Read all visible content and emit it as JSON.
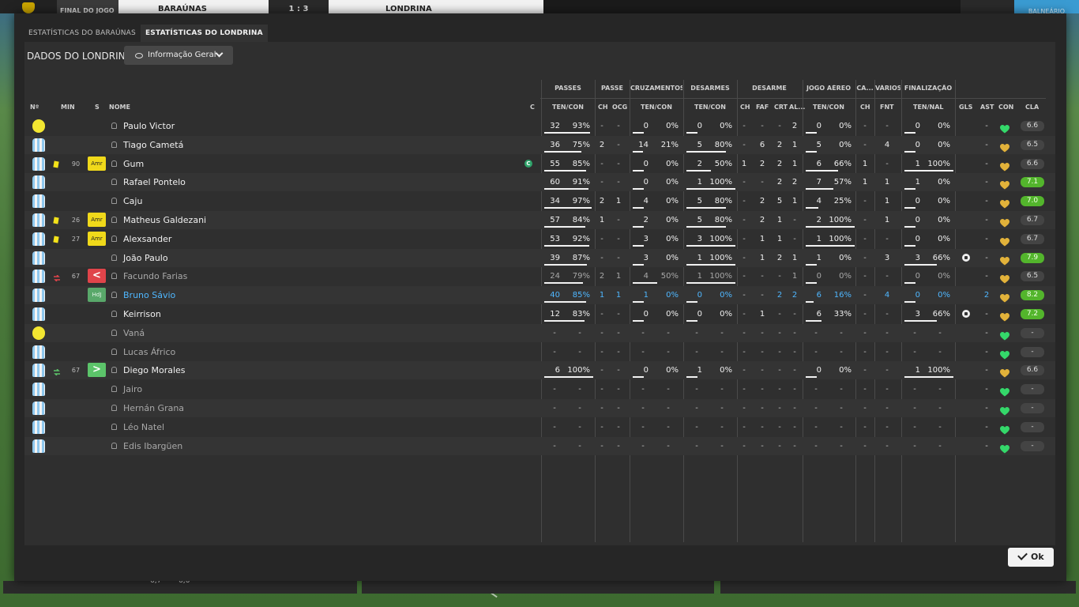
{
  "scoreboard": {
    "status": "FINAL DO JOGO",
    "home": "BARAÚNAS",
    "score": "1 : 3",
    "away": "LONDRINA",
    "right_label": "BALNEÁRIO"
  },
  "tabs": [
    {
      "label": "ESTATÍSTICAS DO BARAÚNAS",
      "active": false
    },
    {
      "label": "ESTATÍSTICAS DO LONDRINA",
      "active": true
    }
  ],
  "panel": {
    "title": "DADOS DO LONDRINA",
    "view_select": "Informação Geral"
  },
  "groups": [
    {
      "label": "PASSES"
    },
    {
      "label": "PASSE"
    },
    {
      "label": "CRUZAMENTOS"
    },
    {
      "label": "DESARMES"
    },
    {
      "label": "DESARME"
    },
    {
      "label": "JOGO AÉREO"
    },
    {
      "label": "CA..."
    },
    {
      "label": "VÁRIOS"
    },
    {
      "label": "FINALIZAÇÃO"
    }
  ],
  "columns": {
    "no": "Nº",
    "min": "MIN",
    "s": "S",
    "nome": "NOME",
    "c": "C",
    "passes": "TEN/CON",
    "passe_ch": "CH",
    "passe_ocg": "OCG",
    "cruz": "TEN/CON",
    "desarmes": "TEN/CON",
    "des_ch": "CH",
    "des_faf": "FAF",
    "des_crt": "CRT",
    "des_al": "AL...",
    "aereo": "TEN/CON",
    "ca_ch": "CH",
    "varios_fnt": "FNT",
    "final": "TEN/NAL",
    "gls": "GLS",
    "ast": "AST",
    "con": "CON",
    "cla": "CLA"
  },
  "players": [
    {
      "name": "Paulo Victor",
      "gk": true,
      "min": "",
      "card": false,
      "sub": "",
      "badge": "",
      "captain": false,
      "style": "",
      "pas": [
        "32",
        "93%"
      ],
      "pasv": 0.93,
      "pch": "-",
      "pocg": "-",
      "cr": [
        "0",
        "0%"
      ],
      "crv": 0,
      "de": [
        "0",
        "0%"
      ],
      "dev": 0,
      "dch": "-",
      "faf": "-",
      "crt": "-",
      "al": "2",
      "ae": [
        "0",
        "0%"
      ],
      "aev": 0,
      "cach": "-",
      "fnt": "-",
      "fi": [
        "0",
        "0%"
      ],
      "fiv": 0,
      "gls": "",
      "ast": "-",
      "heart": "green",
      "rating": "6.6",
      "rg": false
    },
    {
      "name": "Tiago Cametá",
      "gk": false,
      "min": "",
      "card": false,
      "sub": "",
      "badge": "",
      "captain": false,
      "style": "",
      "pas": [
        "36",
        "75%"
      ],
      "pasv": 0.75,
      "pch": "2",
      "pocg": "-",
      "cr": [
        "14",
        "21%"
      ],
      "crv": 0.21,
      "de": [
        "5",
        "80%"
      ],
      "dev": 0.8,
      "dch": "-",
      "faf": "6",
      "crt": "2",
      "al": "1",
      "ae": [
        "5",
        "0%"
      ],
      "aev": 0,
      "cach": "-",
      "fnt": "4",
      "fi": [
        "0",
        "0%"
      ],
      "fiv": 0,
      "gls": "",
      "ast": "-",
      "heart": "gold",
      "rating": "6.5",
      "rg": false
    },
    {
      "name": "Gum",
      "gk": false,
      "min": "90",
      "card": true,
      "sub": "",
      "badge": "Amr",
      "captain": true,
      "captain_mark": "C",
      "style": "",
      "pas": [
        "55",
        "85%"
      ],
      "pasv": 0.85,
      "pch": "-",
      "pocg": "-",
      "cr": [
        "0",
        "0%"
      ],
      "crv": 0,
      "de": [
        "2",
        "50%"
      ],
      "dev": 0.5,
      "dch": "1",
      "faf": "2",
      "crt": "2",
      "al": "1",
      "ae": [
        "6",
        "66%"
      ],
      "aev": 0.66,
      "cach": "1",
      "fnt": "-",
      "fi": [
        "1",
        "100%"
      ],
      "fiv": 1,
      "gls": "",
      "ast": "-",
      "heart": "gold",
      "rating": "6.6",
      "rg": false
    },
    {
      "name": "Rafael Pontelo",
      "gk": false,
      "min": "",
      "card": false,
      "sub": "",
      "badge": "",
      "captain": false,
      "style": "",
      "pas": [
        "60",
        "91%"
      ],
      "pasv": 0.91,
      "pch": "-",
      "pocg": "-",
      "cr": [
        "0",
        "0%"
      ],
      "crv": 0,
      "de": [
        "1",
        "100%"
      ],
      "dev": 1,
      "dch": "-",
      "faf": "-",
      "crt": "2",
      "al": "2",
      "ae": [
        "7",
        "57%"
      ],
      "aev": 0.57,
      "cach": "1",
      "fnt": "1",
      "fi": [
        "1",
        "0%"
      ],
      "fiv": 0,
      "gls": "",
      "ast": "-",
      "heart": "gold",
      "rating": "7.1",
      "rg": true
    },
    {
      "name": "Caju",
      "gk": false,
      "min": "",
      "card": false,
      "sub": "",
      "badge": "",
      "captain": false,
      "style": "",
      "pas": [
        "34",
        "97%"
      ],
      "pasv": 0.97,
      "pch": "2",
      "pocg": "1",
      "cr": [
        "4",
        "0%"
      ],
      "crv": 0,
      "de": [
        "5",
        "80%"
      ],
      "dev": 0.8,
      "dch": "-",
      "faf": "2",
      "crt": "5",
      "al": "1",
      "ae": [
        "4",
        "25%"
      ],
      "aev": 0.25,
      "cach": "-",
      "fnt": "1",
      "fi": [
        "0",
        "0%"
      ],
      "fiv": 0,
      "gls": "",
      "ast": "-",
      "heart": "gold",
      "rating": "7.0",
      "rg": true
    },
    {
      "name": "Matheus Galdezani",
      "gk": false,
      "min": "26",
      "card": true,
      "sub": "",
      "badge": "Amr",
      "captain": false,
      "style": "",
      "pas": [
        "57",
        "84%"
      ],
      "pasv": 0.84,
      "pch": "1",
      "pocg": "-",
      "cr": [
        "2",
        "0%"
      ],
      "crv": 0,
      "de": [
        "5",
        "80%"
      ],
      "dev": 0.8,
      "dch": "-",
      "faf": "2",
      "crt": "1",
      "al": "-",
      "ae": [
        "2",
        "100%"
      ],
      "aev": 1,
      "cach": "-",
      "fnt": "1",
      "fi": [
        "0",
        "0%"
      ],
      "fiv": 0,
      "gls": "",
      "ast": "-",
      "heart": "gold",
      "rating": "6.7",
      "rg": false
    },
    {
      "name": "Alexsander",
      "gk": false,
      "min": "27",
      "card": true,
      "sub": "",
      "badge": "Amr",
      "captain": false,
      "style": "",
      "pas": [
        "53",
        "92%"
      ],
      "pasv": 0.92,
      "pch": "-",
      "pocg": "-",
      "cr": [
        "3",
        "0%"
      ],
      "crv": 0,
      "de": [
        "3",
        "100%"
      ],
      "dev": 1,
      "dch": "-",
      "faf": "1",
      "crt": "1",
      "al": "-",
      "ae": [
        "1",
        "100%"
      ],
      "aev": 1,
      "cach": "-",
      "fnt": "-",
      "fi": [
        "0",
        "0%"
      ],
      "fiv": 0,
      "gls": "",
      "ast": "-",
      "heart": "gold",
      "rating": "6.7",
      "rg": false
    },
    {
      "name": "João Paulo",
      "gk": false,
      "min": "",
      "card": false,
      "sub": "",
      "badge": "",
      "captain": false,
      "style": "",
      "goal": true,
      "pas": [
        "39",
        "87%"
      ],
      "pasv": 0.87,
      "pch": "-",
      "pocg": "-",
      "cr": [
        "3",
        "0%"
      ],
      "crv": 0,
      "de": [
        "1",
        "100%"
      ],
      "dev": 1,
      "dch": "-",
      "faf": "1",
      "crt": "2",
      "al": "1",
      "ae": [
        "1",
        "0%"
      ],
      "aev": 0,
      "cach": "-",
      "fnt": "3",
      "fi": [
        "3",
        "66%"
      ],
      "fiv": 0.66,
      "gls": "",
      "ast": "-",
      "heart": "gold",
      "rating": "7.9",
      "rg": true
    },
    {
      "name": "Facundo Farias",
      "gk": false,
      "min": "67",
      "card": false,
      "sub": "out",
      "badge": "out",
      "captain": false,
      "style": "dim",
      "pas": [
        "24",
        "79%"
      ],
      "pasv": 0.79,
      "pch": "2",
      "pocg": "1",
      "cr": [
        "4",
        "50%"
      ],
      "crv": 0.5,
      "de": [
        "1",
        "100%"
      ],
      "dev": 1,
      "dch": "-",
      "faf": "-",
      "crt": "-",
      "al": "1",
      "ae": [
        "0",
        "0%"
      ],
      "aev": 0,
      "cach": "-",
      "fnt": "-",
      "fi": [
        "0",
        "0%"
      ],
      "fiv": 0,
      "gls": "",
      "ast": "-",
      "heart": "gold",
      "rating": "6.5",
      "rg": false
    },
    {
      "name": "Bruno Sávio",
      "gk": false,
      "min": "",
      "card": false,
      "sub": "",
      "badge": "HdJ",
      "captain": false,
      "style": "blue",
      "pas": [
        "40",
        "85%"
      ],
      "pasv": 0.85,
      "pch": "1",
      "pocg": "1",
      "cr": [
        "1",
        "0%"
      ],
      "crv": 0,
      "de": [
        "0",
        "0%"
      ],
      "dev": 0,
      "dch": "-",
      "faf": "-",
      "crt": "2",
      "al": "2",
      "ae": [
        "6",
        "16%"
      ],
      "aev": 0.16,
      "cach": "-",
      "fnt": "4",
      "fi": [
        "0",
        "0%"
      ],
      "fiv": 0,
      "gls": "",
      "ast": "2",
      "heart": "gold",
      "rating": "8.2",
      "rg": true
    },
    {
      "name": "Keirrison",
      "gk": false,
      "min": "",
      "card": false,
      "sub": "",
      "badge": "",
      "captain": false,
      "style": "",
      "goal": true,
      "pas": [
        "12",
        "83%"
      ],
      "pasv": 0.83,
      "pch": "-",
      "pocg": "-",
      "cr": [
        "0",
        "0%"
      ],
      "crv": 0,
      "de": [
        "0",
        "0%"
      ],
      "dev": 0,
      "dch": "-",
      "faf": "1",
      "crt": "-",
      "al": "-",
      "ae": [
        "6",
        "33%"
      ],
      "aev": 0.33,
      "cach": "-",
      "fnt": "-",
      "fi": [
        "3",
        "66%"
      ],
      "fiv": 0.66,
      "gls": "",
      "ast": "-",
      "heart": "gold",
      "rating": "7.2",
      "rg": true
    },
    {
      "name": "Vaná",
      "gk": true,
      "min": "",
      "card": false,
      "sub": "",
      "badge": "",
      "captain": false,
      "style": "dim",
      "empty": true,
      "heart": "green",
      "rating": "-",
      "rg": false
    },
    {
      "name": "Lucas Áfrico",
      "gk": false,
      "min": "",
      "card": false,
      "sub": "",
      "badge": "",
      "captain": false,
      "style": "dim",
      "empty": true,
      "heart": "green",
      "rating": "-",
      "rg": false
    },
    {
      "name": "Diego Morales",
      "gk": false,
      "min": "67",
      "card": false,
      "sub": "in",
      "badge": "in",
      "captain": false,
      "style": "",
      "pas": [
        "6",
        "100%"
      ],
      "pasv": 1,
      "pch": "-",
      "pocg": "-",
      "cr": [
        "0",
        "0%"
      ],
      "crv": 0,
      "de": [
        "1",
        "0%"
      ],
      "dev": 0,
      "dch": "-",
      "faf": "-",
      "crt": "-",
      "al": "-",
      "ae": [
        "0",
        "0%"
      ],
      "aev": 0,
      "cach": "-",
      "fnt": "-",
      "fi": [
        "1",
        "100%"
      ],
      "fiv": 1,
      "gls": "",
      "ast": "-",
      "heart": "gold",
      "rating": "6.6",
      "rg": false
    },
    {
      "name": "Jairo",
      "gk": false,
      "min": "",
      "card": false,
      "sub": "",
      "badge": "",
      "captain": false,
      "style": "dim",
      "empty": true,
      "heart": "green",
      "rating": "-",
      "rg": false
    },
    {
      "name": "Hernán Grana",
      "gk": false,
      "min": "",
      "card": false,
      "sub": "",
      "badge": "",
      "captain": false,
      "style": "dim",
      "empty": true,
      "heart": "green",
      "rating": "-",
      "rg": false
    },
    {
      "name": "Léo Natel",
      "gk": false,
      "min": "",
      "card": false,
      "sub": "",
      "badge": "",
      "captain": false,
      "style": "dim",
      "empty": true,
      "heart": "green",
      "rating": "-",
      "rg": false
    },
    {
      "name": "Edis Ibargüen",
      "gk": false,
      "min": "",
      "card": false,
      "sub": "",
      "badge": "",
      "captain": false,
      "style": "dim",
      "empty": true,
      "heart": "green",
      "rating": "-",
      "rg": false
    }
  ],
  "badge_labels": {
    "amr": "Amr",
    "hdj": "HdJ",
    "out": "<",
    "in": ">"
  },
  "ok_label": "Ok",
  "bottom": {
    "left_a": "6,7",
    "left_b": "6,6"
  },
  "colors": {
    "heart_green": "#34d86a",
    "heart_gold": "#e2b23a",
    "rating_green": "#53b52c",
    "accent_blue": "#4fb7ff"
  }
}
